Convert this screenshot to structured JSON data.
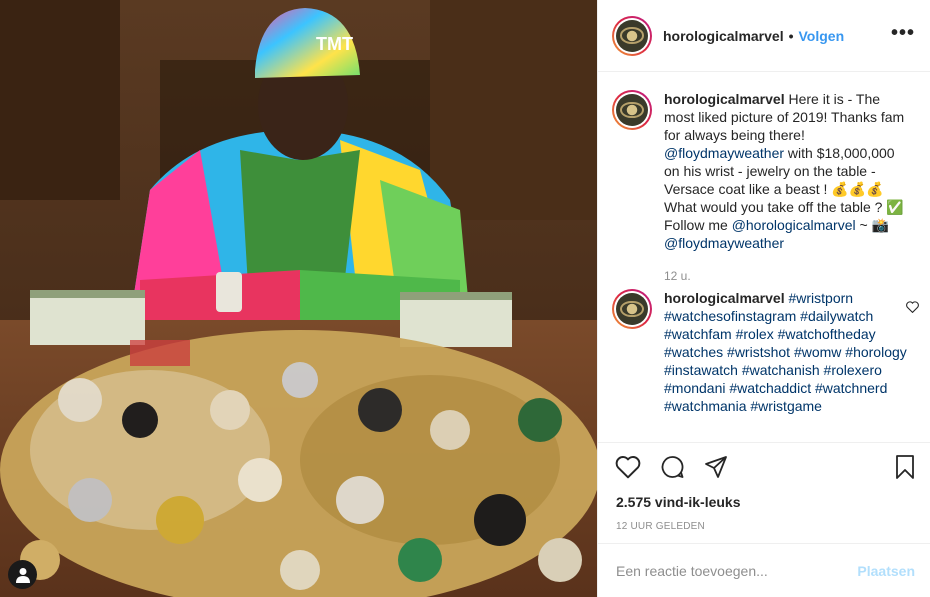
{
  "header": {
    "username": "horologicalmarvel",
    "dot": "•",
    "follow_label": "Volgen",
    "more_label": "•••"
  },
  "caption": {
    "username": "horologicalmarvel",
    "text_1": " Here it is - The most liked picture of 2019! Thanks fam for always being there! ",
    "mention_1": "@floydmayweather",
    "text_2": " with $18,000,000 on his wrist - jewelry on the table - Versace coat like a beast ! 💰💰💰 What would you take off the table ? ✅ Follow me ",
    "mention_2": "@horologicalmarvel",
    "text_3": " ~ 📸 ",
    "mention_3": "@floydmayweather",
    "time": "12 u."
  },
  "hashtag_comment": {
    "username": "horologicalmarvel",
    "tags": "#wristporn #watchesofinstagram #dailywatch #watchfam #rolex #watchoftheday #watches #wristshot #womw #horology #instawatch #watchanish #rolexero #mondani #watchaddict #watchnerd #watchmania #wristgame"
  },
  "actions": {
    "likes": "2.575 vind-ik-leuks",
    "posted": "12 UUR GELEDEN"
  },
  "add_comment": {
    "placeholder": "Een reactie toevoegen...",
    "post_label": "Plaatsen"
  },
  "colors": {
    "link": "#003569",
    "follow": "#3897f0",
    "post_disabled": "#b2dffc",
    "muted": "#8e8e8e"
  }
}
